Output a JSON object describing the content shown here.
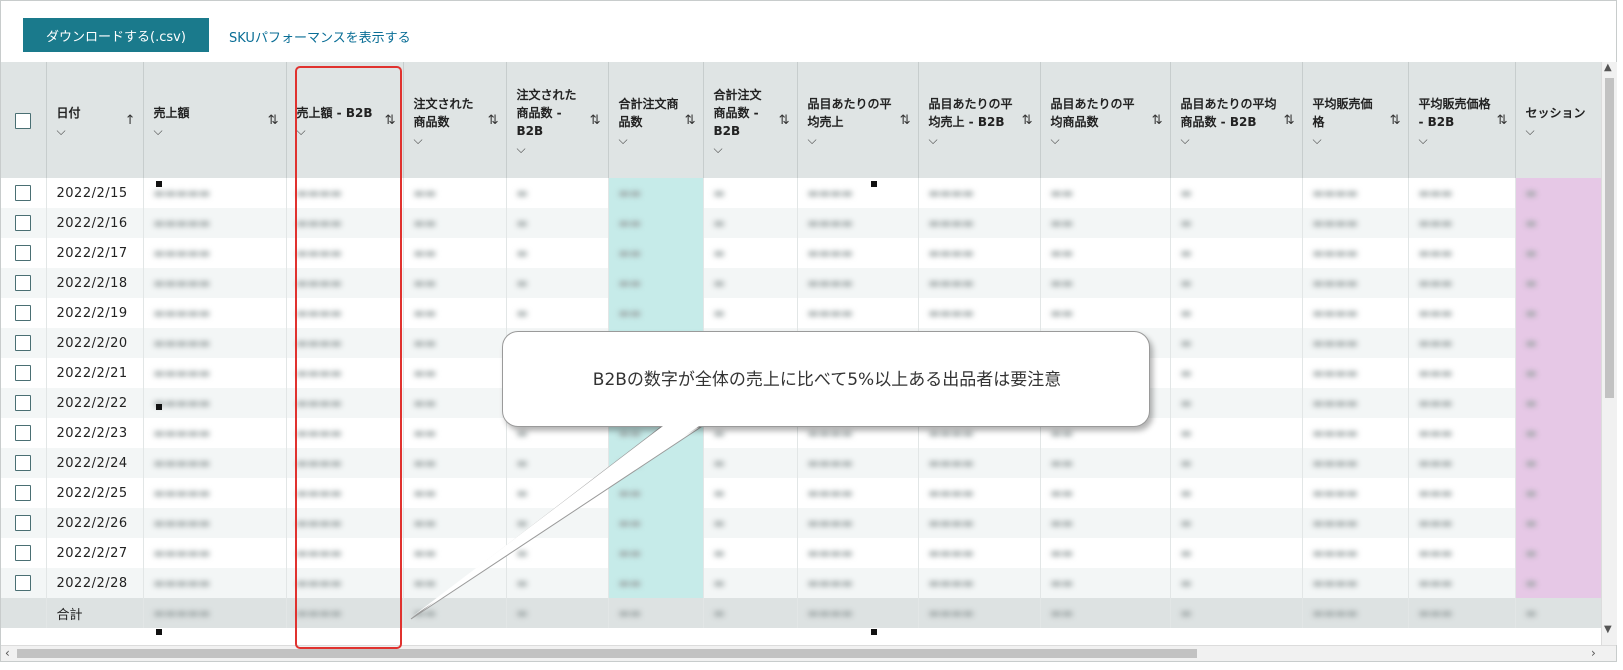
{
  "toolbar": {
    "download_label": "ダウンロードする(.csv)",
    "sku_link_label": "SKUパフォーマンスを表示する"
  },
  "table": {
    "columns": [
      {
        "label": "日付",
        "sort": "↑",
        "chevron": "⌵"
      },
      {
        "label": "売上額",
        "sort": "⇅",
        "chevron": "⌵"
      },
      {
        "label": "売上額 - B2B",
        "sort": "⇅",
        "chevron": "⌵"
      },
      {
        "label": "注文された商品数",
        "sort": "⇅",
        "chevron": "⌵"
      },
      {
        "label": "注文された商品数 - B2B",
        "sort": "⇅",
        "chevron": "⌵"
      },
      {
        "label": "合計注文商品数",
        "sort": "⇅",
        "chevron": "⌵"
      },
      {
        "label": "合計注文商品数 - B2B",
        "sort": "⇅",
        "chevron": "⌵"
      },
      {
        "label": "品目あたりの平均売上",
        "sort": "⇅",
        "chevron": "⌵"
      },
      {
        "label": "品目あたりの平均売上 - B2B",
        "sort": "⇅",
        "chevron": "⌵"
      },
      {
        "label": "品目あたりの平均商品数",
        "sort": "⇅",
        "chevron": "⌵"
      },
      {
        "label": "品目あたりの平均商品数 - B2B",
        "sort": "⇅",
        "chevron": "⌵"
      },
      {
        "label": "平均販売価格",
        "sort": "⇅",
        "chevron": "⌵"
      },
      {
        "label": "平均販売価格 - B2B",
        "sort": "⇅",
        "chevron": "⌵"
      },
      {
        "label": "セッション",
        "sort": "",
        "chevron": "⌵"
      }
    ],
    "dates": [
      "2022/2/15",
      "2022/2/16",
      "2022/2/17",
      "2022/2/18",
      "2022/2/19",
      "2022/2/20",
      "2022/2/21",
      "2022/2/22",
      "2022/2/23",
      "2022/2/24",
      "2022/2/25",
      "2022/2/26",
      "2022/2/27",
      "2022/2/28"
    ],
    "footer_label": "合計"
  },
  "callout": {
    "text": "B2Bの数字が全体の売上に比べて5%以上ある出品者は要注意"
  },
  "colors": {
    "primary_button": "#1a7a8c",
    "link": "#0a6e96",
    "highlight_border": "#e0322f",
    "total_column": "#c6ebe9",
    "session_column": "#e6c8e6"
  }
}
